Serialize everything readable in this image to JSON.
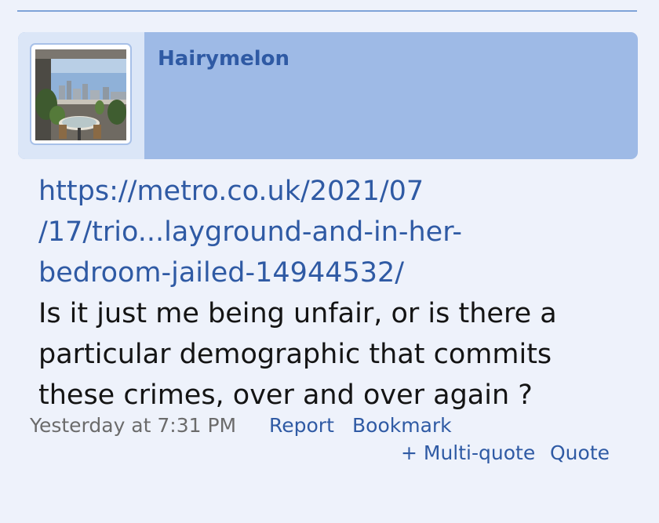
{
  "post": {
    "username": "Hairymelon",
    "link_lines": [
      "https://metro.co.uk/2021/07",
      "/17/trio...layground-and-in-her-",
      "bedroom-jailed-14944532/"
    ],
    "text_lines": [
      "Is it just me being unfair, or is there a",
      "particular demographic that commits",
      "these crimes, over and over again ?"
    ],
    "timestamp": "Yesterday at 7:31 PM",
    "actions": {
      "report": "Report",
      "bookmark": "Bookmark",
      "multi_quote": "+ Multi-quote",
      "quote": "Quote"
    }
  },
  "colors": {
    "header_bg": "#9ebae6",
    "link": "#2f5aa4",
    "page_bg": "#eef2fb"
  },
  "icons": {
    "avatar": "balcony-photo"
  }
}
